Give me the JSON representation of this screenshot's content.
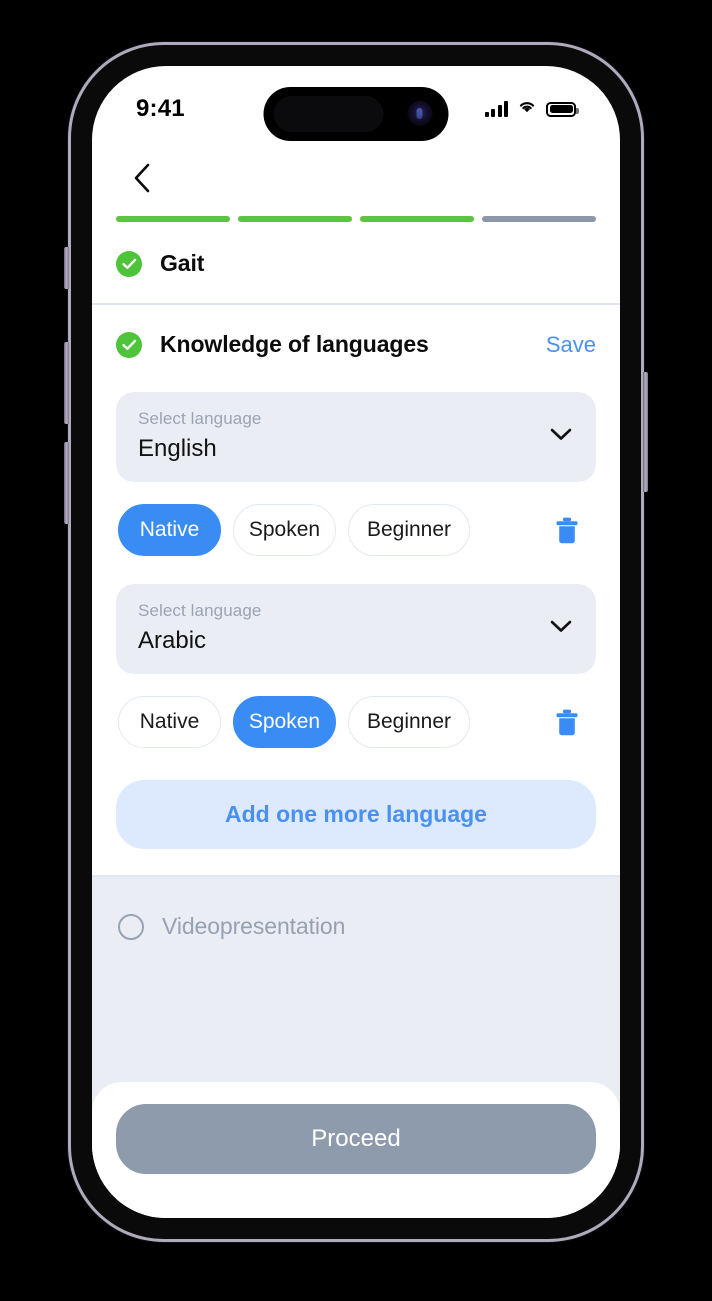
{
  "device": {
    "status_bar": {
      "time": "9:41",
      "cellular_icon": "signal-bars-icon",
      "wifi_icon": "wifi-icon",
      "battery_icon": "battery-full-icon"
    }
  },
  "nav": {
    "back_icon": "chevron-left-icon"
  },
  "progress": {
    "segments": [
      {
        "state": "done"
      },
      {
        "state": "done"
      },
      {
        "state": "done"
      },
      {
        "state": "todo"
      }
    ],
    "completed_count": 3,
    "total_count": 4,
    "done_color": "#5cc442",
    "todo_color": "#8c97aa"
  },
  "sections": {
    "gait": {
      "title": "Gait",
      "status_icon": "check-circle-icon",
      "completed": true
    },
    "languages": {
      "title": "Knowledge of languages",
      "status_icon": "check-circle-icon",
      "completed": true,
      "save_label": "Save",
      "save_color": "#4a90f2",
      "items": [
        {
          "field_label": "Select language",
          "language": "English",
          "dropdown_icon": "chevron-down-icon",
          "levels": [
            "Native",
            "Spoken",
            "Beginner"
          ],
          "selected_level": "Native",
          "delete_icon": "trash-icon"
        },
        {
          "field_label": "Select language",
          "language": "Arabic",
          "dropdown_icon": "chevron-down-icon",
          "levels": [
            "Native",
            "Spoken",
            "Beginner"
          ],
          "selected_level": "Spoken",
          "delete_icon": "trash-icon"
        }
      ],
      "add_label": "Add one more language"
    },
    "videopresentation": {
      "title": "Videopresentation",
      "status_icon": "empty-circle-icon",
      "completed": false,
      "disabled": true
    }
  },
  "footer": {
    "proceed_label": "Proceed",
    "proceed_enabled": false,
    "proceed_color": "#8e9bad"
  }
}
